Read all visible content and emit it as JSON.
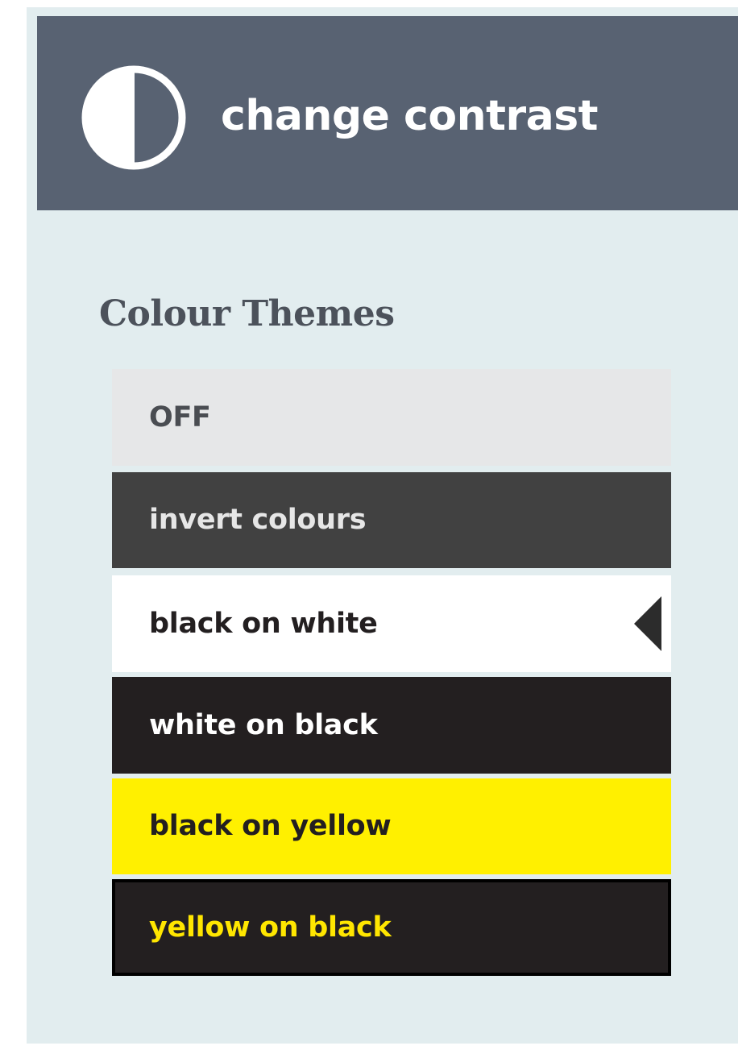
{
  "header": {
    "title": "change contrast",
    "icon": "contrast-half-circle-icon",
    "background": "#586272"
  },
  "section": {
    "title": "Colour Themes"
  },
  "themes": [
    {
      "label": "OFF",
      "background": "#e6e7e8",
      "color": "#4a4d52",
      "selected": false
    },
    {
      "label": "invert colours",
      "background": "#414141",
      "color": "#e6e6e6",
      "selected": false
    },
    {
      "label": "black on white",
      "background": "#ffffff",
      "color": "#231f20",
      "selected": true
    },
    {
      "label": "white on black",
      "background": "#231f20",
      "color": "#ffffff",
      "selected": false
    },
    {
      "label": "black on yellow",
      "background": "#fff000",
      "color": "#231f20",
      "selected": false
    },
    {
      "label": "yellow on black",
      "background": "#231f20",
      "color": "#ffe600",
      "selected": false
    }
  ]
}
